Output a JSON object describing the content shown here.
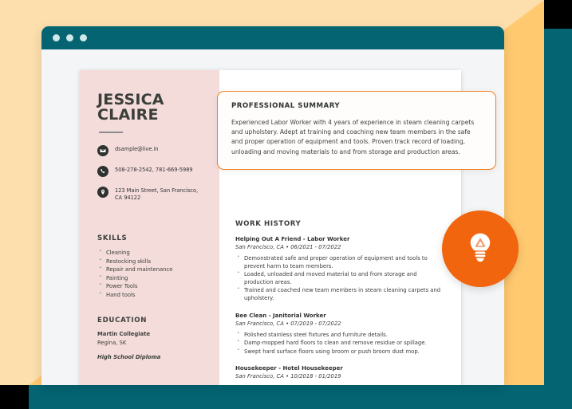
{
  "colors": {
    "teal": "#046472",
    "peach_light": "#fddfae",
    "peach": "#ffc970",
    "pink_panel": "#f4dcdb",
    "orange_accent": "#ef7f21",
    "badge_orange": "#f2650f",
    "text_dark": "#3b3f3a",
    "black_block": "#000000"
  },
  "browser": {
    "traffic_lights": [
      "close",
      "minimize",
      "maximize"
    ]
  },
  "resume": {
    "name_line1": "JESSICA",
    "name_line2": "CLAIRE",
    "contacts": [
      {
        "icon": "envelope-icon",
        "text": "dsample@live.in"
      },
      {
        "icon": "phone-icon",
        "text": "508-278-2542, 781-669-5989"
      },
      {
        "icon": "location-pin-icon",
        "text": "123 Main Street, San Francisco, CA 94122"
      }
    ],
    "skills": {
      "title": "SKILLS",
      "items": [
        "Cleaning",
        "Restocking skills",
        "Repair and maintenance",
        "Painting",
        "Power Tools",
        "Hand tools"
      ]
    },
    "education": {
      "title": "EDUCATION",
      "school": "Martin Collegiate",
      "location": "Regina, SK",
      "degree": "High School Diploma"
    },
    "work_history": {
      "title": "WORK HISTORY",
      "jobs": [
        {
          "header": "Helping Out A Friend - Labor Worker",
          "meta": "San Francisco, CA  •  06/2021 - 07/2022",
          "bullets": [
            "Demonstrated safe and proper operation of equipment and tools to prevent harm to team members.",
            "Loaded, unloaded and moved material to and from storage and production areas.",
            "Trained and coached new team members in steam cleaning carpets and upholstery."
          ]
        },
        {
          "header": "Bee Clean - Janitorial Worker",
          "meta": "San Francisco, CA  •  07/2019 - 07/2022",
          "bullets": [
            "Polished stainless steel fixtures and furniture details.",
            "Damp-mopped hard floors to clean and remove residue or spillage.",
            "Swept hard surface floors using broom or push broom dust mop."
          ]
        },
        {
          "header": "Housekeeper - Hotel Housekeeper",
          "meta": "San Francisco, CA  •  10/2018 - 01/2019",
          "bullets": []
        }
      ]
    }
  },
  "callout": {
    "title": "PROFESSIONAL SUMMARY",
    "body": "Experienced Labor Worker with 4 years of experience in steam cleaning carpets and upholstery. Adept at training and coaching new team members in the safe and proper operation of equipment and tools. Proven track record of loading, unloading and moving materials to and from storage and production areas."
  },
  "badge": {
    "icon": "lightbulb-icon"
  }
}
